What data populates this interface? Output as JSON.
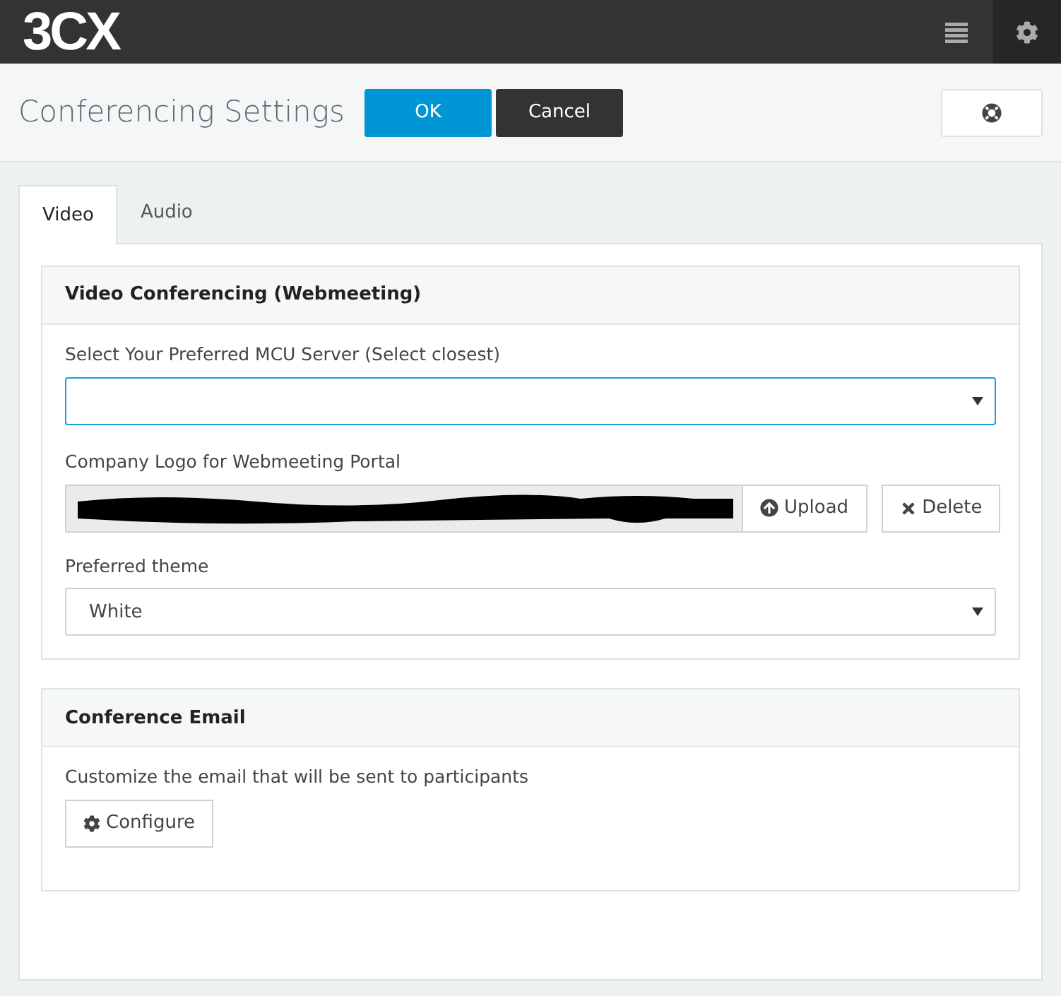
{
  "topbar": {
    "logo": "3CX"
  },
  "header": {
    "title": "Conferencing Settings",
    "buttons": [
      {
        "label": "OK",
        "kind": "primary"
      },
      {
        "label": "Cancel",
        "kind": "dark"
      }
    ]
  },
  "tabs": [
    {
      "label": "Video",
      "selected": true
    },
    {
      "label": "Audio",
      "selected": false
    }
  ],
  "video_conferencing": {
    "title": "Video Conferencing (Webmeeting)",
    "mcu_label": "Select Your Preferred MCU Server (Select closest)",
    "mcu_focused": true,
    "logo_label": "Company Logo for Webmeeting Portal",
    "upload_button": "Upload",
    "delete_button": "Delete",
    "theme_label": "Preferred theme",
    "theme_value": "White"
  },
  "conference_email": {
    "title": "Conference Email",
    "description": "Customize the email that will be sent to participants",
    "configure_button": "Configure"
  }
}
